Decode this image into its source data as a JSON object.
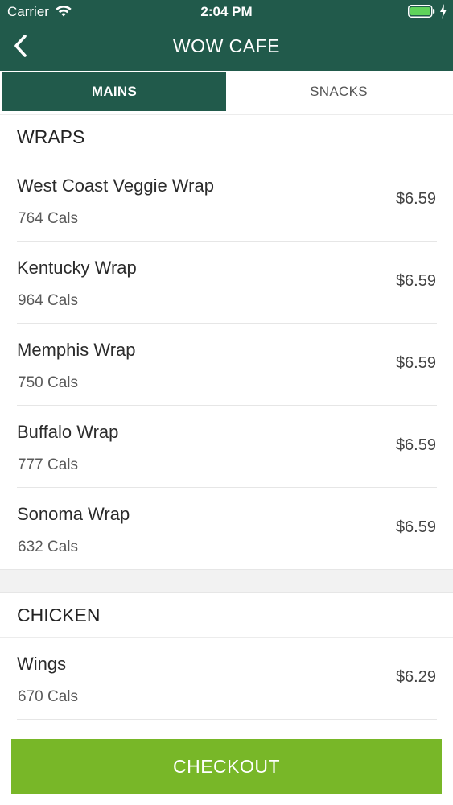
{
  "status_bar": {
    "carrier": "Carrier",
    "time": "2:04 PM"
  },
  "nav": {
    "title": "WOW CAFE",
    "back_icon": "chevron-left-icon"
  },
  "tabs": [
    {
      "label": "MAINS",
      "active": true
    },
    {
      "label": "SNACKS",
      "active": false
    }
  ],
  "sections": [
    {
      "title": "WRAPS",
      "items": [
        {
          "name": "West Coast Veggie Wrap",
          "cals": "764 Cals",
          "price": "$6.59"
        },
        {
          "name": "Kentucky Wrap",
          "cals": "964 Cals",
          "price": "$6.59"
        },
        {
          "name": "Memphis Wrap",
          "cals": "750 Cals",
          "price": "$6.59"
        },
        {
          "name": "Buffalo Wrap",
          "cals": "777 Cals",
          "price": "$6.59"
        },
        {
          "name": "Sonoma Wrap",
          "cals": "632 Cals",
          "price": "$6.59"
        }
      ]
    },
    {
      "title": "CHICKEN",
      "items": [
        {
          "name": "Wings",
          "cals": "670 Cals",
          "price": "$6.29"
        }
      ]
    }
  ],
  "checkout": {
    "label": "CHECKOUT"
  },
  "colors": {
    "primary": "#215a4b",
    "accent": "#78b728"
  }
}
